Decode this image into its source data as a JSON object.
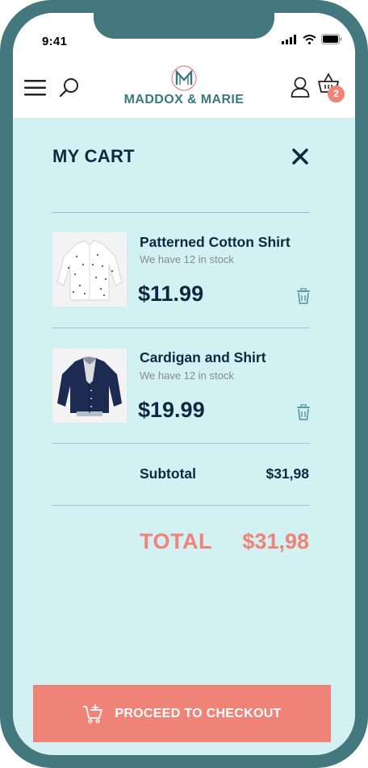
{
  "status_bar": {
    "time": "9:41"
  },
  "header": {
    "brand": "MADDOX & MARIE",
    "cart_count": "2",
    "icons": [
      "menu-icon",
      "search-icon",
      "logo-icon",
      "user-icon",
      "basket-icon"
    ]
  },
  "cart": {
    "title": "MY CART",
    "items": [
      {
        "name": "Patterned Cotton Shirt",
        "stock": "We have 12 in stock",
        "price": "$11.99",
        "image": "white-patterned-shirt"
      },
      {
        "name": "Cardigan and Shirt",
        "stock": "We have 12 in stock",
        "price": "$19.99",
        "image": "navy-cardigan"
      }
    ],
    "subtotal_label": "Subtotal",
    "subtotal_value": "$31,98",
    "total_label": "TOTAL",
    "total_value": "$31,98"
  },
  "checkout": {
    "label": "PROCEED TO CHECKOUT"
  },
  "colors": {
    "accent": "#ef8378",
    "background": "#d3f0f2",
    "frame": "#43787f",
    "text": "#0f2742",
    "brand": "#3a7880"
  }
}
